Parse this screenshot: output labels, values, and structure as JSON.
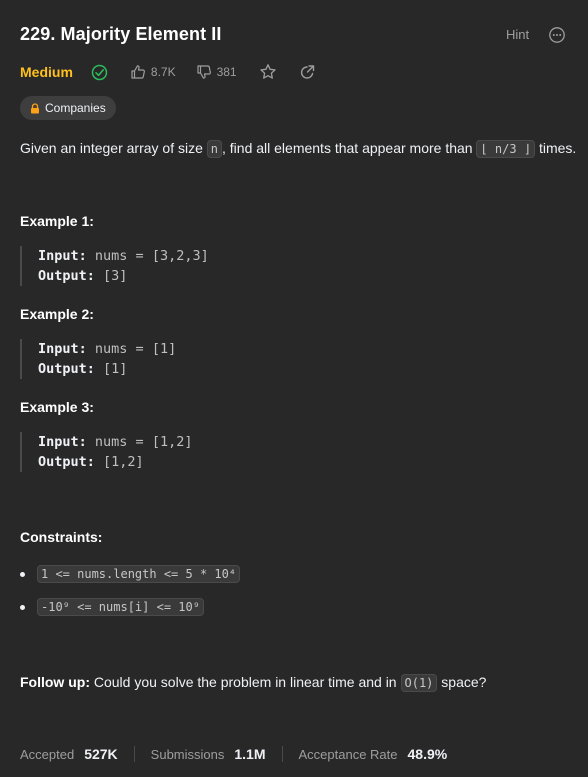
{
  "problem": {
    "title": "229. Majority Element II",
    "hint_label": "Hint",
    "difficulty": "Medium",
    "likes": "8.7K",
    "dislikes": "381",
    "companies_label": "Companies"
  },
  "description": {
    "part1": "Given an integer array of size ",
    "code_n": "n",
    "part2": ", find all elements that appear more than ",
    "code_floor": "⌊ n/3 ⌋",
    "part3": " times."
  },
  "examples": [
    {
      "title": "Example 1:",
      "input_label": "Input:",
      "input": "nums = [3,2,3]",
      "output_label": "Output:",
      "output": "[3]"
    },
    {
      "title": "Example 2:",
      "input_label": "Input:",
      "input": "nums = [1]",
      "output_label": "Output:",
      "output": "[1]"
    },
    {
      "title": "Example 3:",
      "input_label": "Input:",
      "input": "nums = [1,2]",
      "output_label": "Output:",
      "output": "[1,2]"
    }
  ],
  "constraints": {
    "title": "Constraints:",
    "items": [
      "1 <= nums.length <= 5 * 10⁴",
      "-10⁹ <= nums[i] <= 10⁹"
    ]
  },
  "followup": {
    "label": "Follow up:",
    "part1": " Could you solve the problem in linear time and in ",
    "code": "O(1)",
    "part2": " space?"
  },
  "stats": {
    "accepted_label": "Accepted",
    "accepted_value": "527K",
    "submissions_label": "Submissions",
    "submissions_value": "1.1M",
    "rate_label": "Acceptance Rate",
    "rate_value": "48.9%"
  },
  "colors": {
    "background": "#282828",
    "difficulty_medium": "#ffc01e",
    "solved_check": "#2cbb5d",
    "companies_lock": "#ffa116"
  }
}
